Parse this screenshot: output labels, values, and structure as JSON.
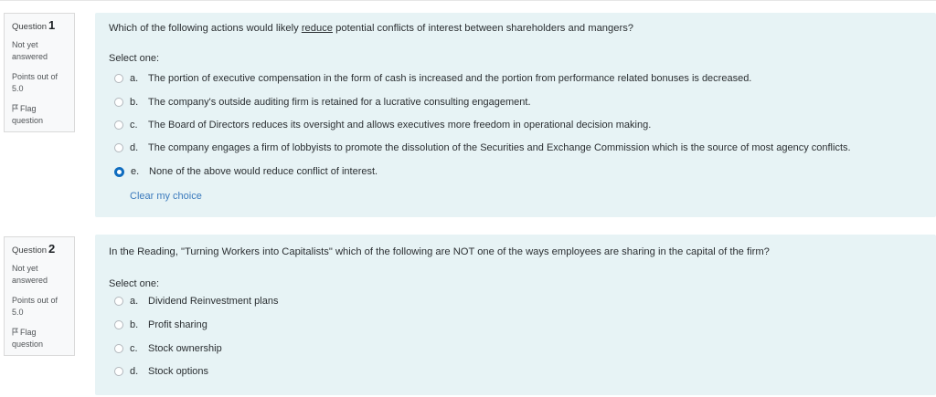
{
  "questions": [
    {
      "number_label": "Question",
      "number": "1",
      "state": [
        "Not yet",
        "answered"
      ],
      "marks": [
        "Points out of",
        "5.0"
      ],
      "flag": [
        "Flag",
        "question"
      ],
      "text_before": "Which of the following actions would likely ",
      "text_emphasis": "reduce",
      "text_after": " potential conflicts of interest between shareholders and mangers?",
      "prompt": "Select one:",
      "options": [
        {
          "letter": "a.",
          "text": "The portion of executive compensation in the form of cash is increased and the portion from performance related bonuses is decreased.",
          "selected": false
        },
        {
          "letter": "b.",
          "text": "The company's outside auditing firm is retained for a lucrative consulting engagement.",
          "selected": false
        },
        {
          "letter": "c.",
          "text": "The Board of Directors reduces its oversight and allows executives more freedom in operational decision making.",
          "selected": false
        },
        {
          "letter": "d.",
          "text": "The company engages a firm of lobbyists to promote the dissolution of the Securities and Exchange Commission which is the source of most agency conflicts.",
          "selected": false
        },
        {
          "letter": "e.",
          "text": "None of the above would reduce conflict of interest.",
          "selected": true
        }
      ],
      "clear_label": "Clear my choice"
    },
    {
      "number_label": "Question",
      "number": "2",
      "state": [
        "Not yet",
        "answered"
      ],
      "marks": [
        "Points out of",
        "5.0"
      ],
      "flag": [
        "Flag",
        "question"
      ],
      "text": "In the Reading, \"Turning Workers into Capitalists\" which of the following are NOT one of the ways employees are sharing in the capital of the firm?",
      "prompt": "Select one:",
      "options": [
        {
          "letter": "a.",
          "text": "Dividend Reinvestment plans",
          "selected": false
        },
        {
          "letter": "b.",
          "text": "Profit sharing",
          "selected": false
        },
        {
          "letter": "c.",
          "text": "Stock ownership",
          "selected": false
        },
        {
          "letter": "d.",
          "text": "Stock options",
          "selected": false
        }
      ]
    }
  ],
  "colors": {
    "accent": "#0f6cbf",
    "panel": "#e7f3f5",
    "link": "#3c7bbd"
  },
  "icons": {
    "flag": "flag-icon"
  }
}
